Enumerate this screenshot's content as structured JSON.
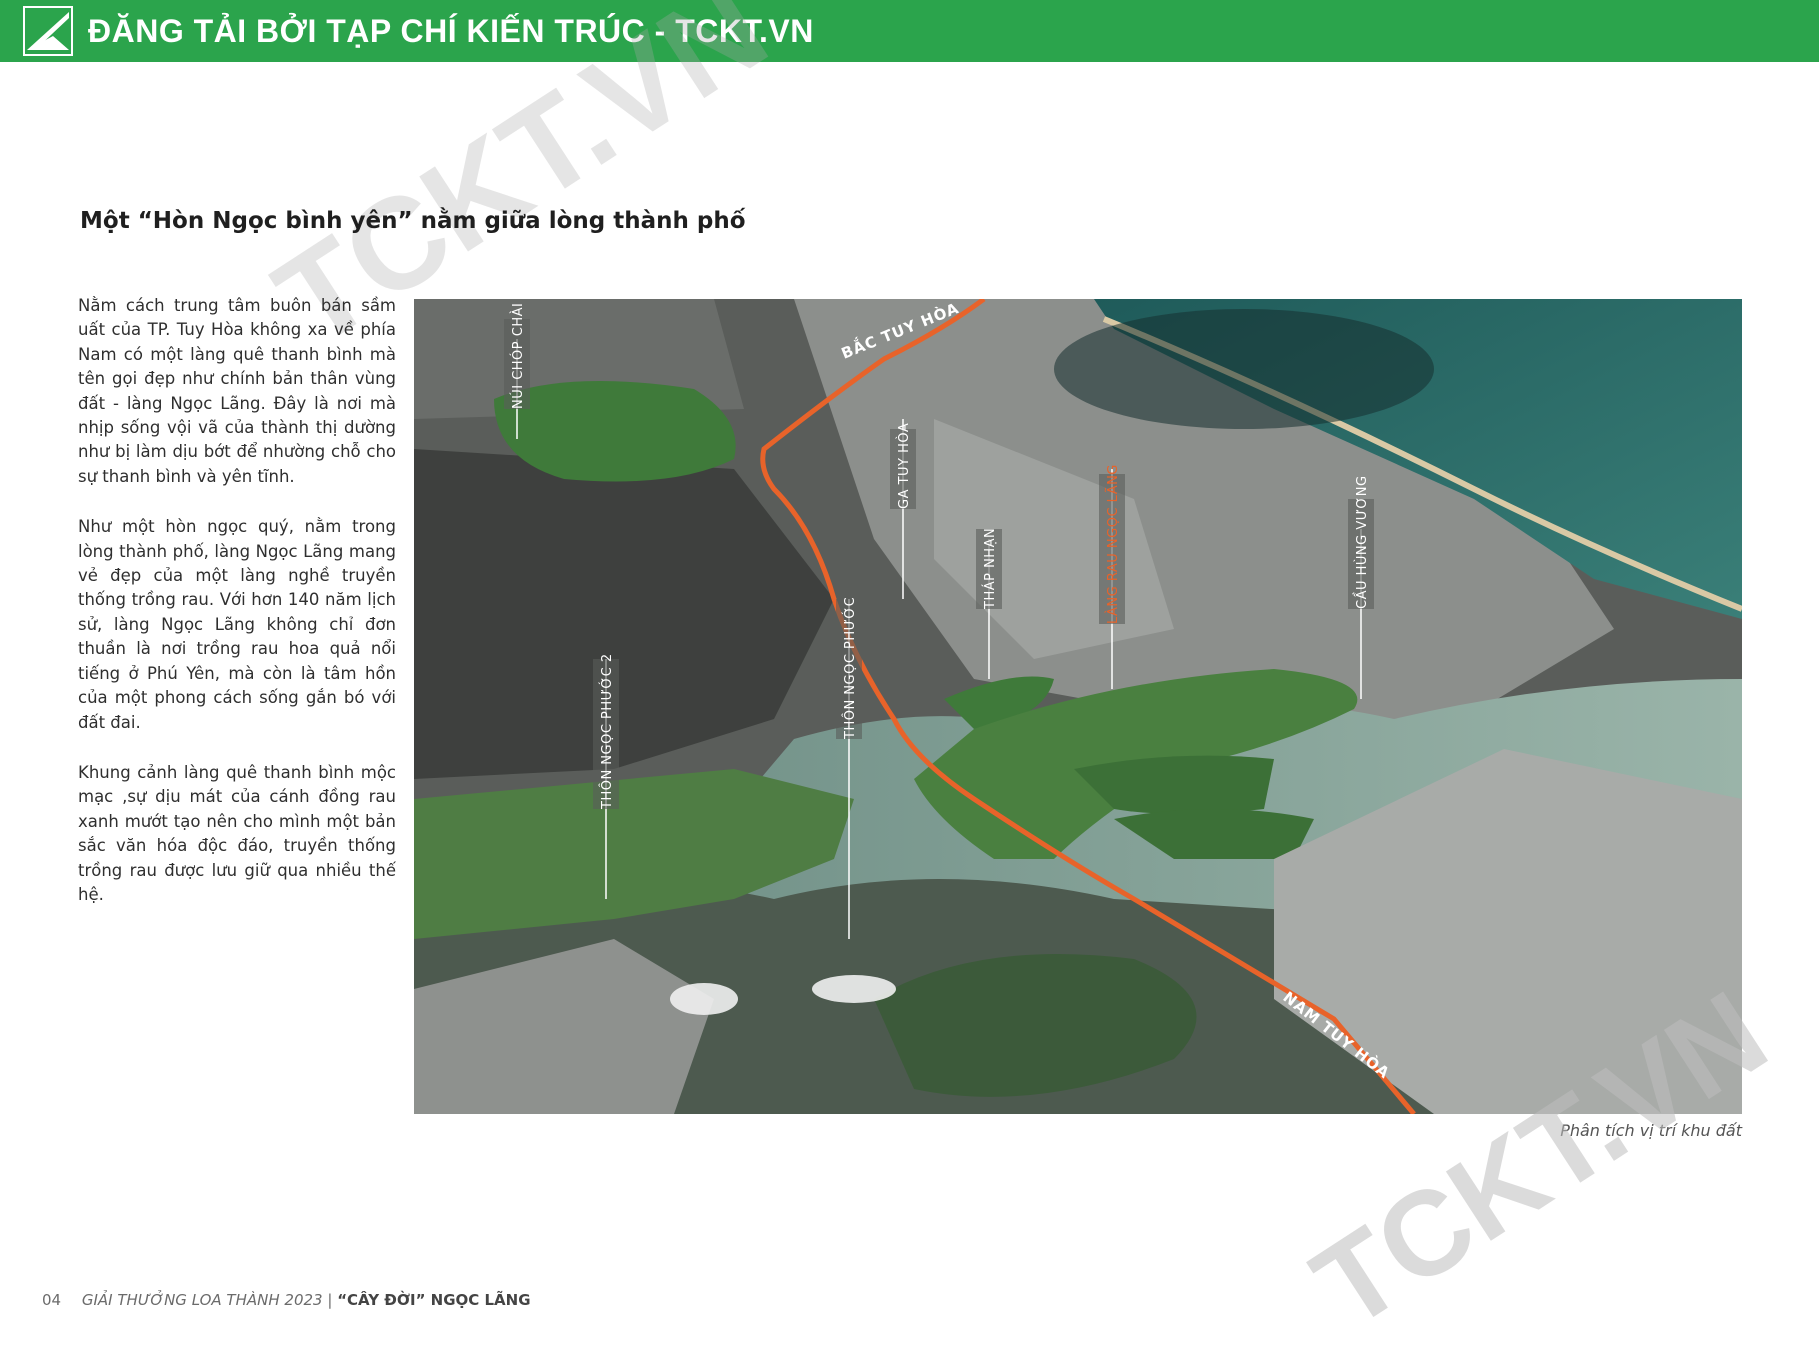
{
  "header": {
    "banner": "ĐĂNG TẢI BỞI TẠP CHÍ KIẾN TRÚC - TCKT.VN",
    "logo_icon": "tckt-logo-icon"
  },
  "section": {
    "title": "Một “Hòn Ngọc bình yên” nằm giữa lòng thành phố",
    "paragraphs": [
      "Nằm cách trung tâm buôn bán sầm uất của TP. Tuy Hòa không xa về phía Nam có một làng quê thanh bình mà tên gọi đẹp như chính bản thân vùng đất - làng Ngọc Lãng. Đây là nơi mà nhịp sống vội vã của thành thị dường như bị làm dịu bớt để nhường chỗ cho sự thanh bình và yên tĩnh.",
      "Như một hòn ngọc quý, nằm trong lòng thành phố, làng Ngọc Lãng mang vẻ đẹp của một làng nghề truyền thống trồng rau. Với hơn 140 năm lịch sử, làng Ngọc Lãng không chỉ đơn thuần là nơi trồng rau hoa quả nổi tiếng ở Phú Yên, mà còn là tâm hồn của một phong cách sống gắn bó với đất đai.",
      "Khung cảnh làng quê thanh bình mộc mạc ,sự dịu mát của cánh đồng rau xanh mướt tạo nên cho mình một bản sắc văn hóa độc đáo, truyền thống trồng rau được lưu giữ qua nhiều thế hệ."
    ]
  },
  "map": {
    "labels": {
      "nui_chop_chai": "NÚI CHÓP CHÀI",
      "ga_tuy_hoa": "GA TUY HÒA",
      "thap_nhan": "THÁP NHẠN",
      "lang_rau": "LÀNG RAU NGỌC LÃNG",
      "cau_hung_vuong": "CẦU HÙNG VƯƠNG",
      "thon_ngoc_phuoc": "THÔN NGỌC PHƯỚC",
      "thon_ngoc_phuoc_2": "THÔN NGỌC PHƯỚC 2",
      "bac_tuy_hoa": "BẮC TUY HÒA",
      "nam_tuy_hoa": "NAM TUY HÒA"
    },
    "colors": {
      "route": "#e8632a",
      "highlight_label": "#e8632a",
      "vegetation": "#3f7a3a",
      "sea": "#2f6f68"
    }
  },
  "caption": "Phân tích vị trí khu đất",
  "footer": {
    "page_number": "04",
    "award": "GIẢI THƯỞNG LOA THÀNH 2023 |",
    "project": "“CÂY ĐỜI” NGỌC LÃNG"
  },
  "watermark": {
    "text_top": "TCKT.VN",
    "text_bottom": "TCKT.VN"
  }
}
